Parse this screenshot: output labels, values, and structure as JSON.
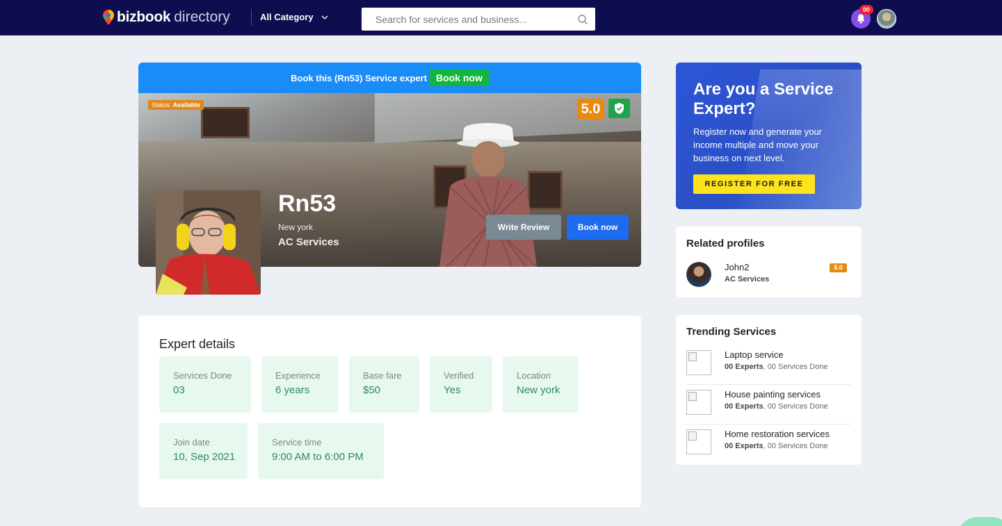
{
  "header": {
    "brand_bold": "bizbook",
    "brand_light": "directory",
    "category_label": "All Category",
    "search_placeholder": "Search for services and business...",
    "notification_count": "00"
  },
  "hero": {
    "banner_text": "Book this (Rn53) Service expert",
    "banner_button": "Book now",
    "status_label": "Status:",
    "status_value": "Available",
    "rating": "5.0",
    "name": "Rn53",
    "city": "New york",
    "service": "AC Services",
    "write_review": "Write Review",
    "book_now": "Book now"
  },
  "details": {
    "title": "Expert details",
    "items": [
      {
        "label": "Services Done",
        "value": "03"
      },
      {
        "label": "Experience",
        "value": "6 years"
      },
      {
        "label": "Base fare",
        "value": "$50"
      },
      {
        "label": "Verified",
        "value": "Yes"
      },
      {
        "label": "Location",
        "value": "New york"
      },
      {
        "label": "Join date",
        "value": "10, Sep 2021"
      },
      {
        "label": "Service time",
        "value": "9:00 AM to 6:00 PM"
      }
    ]
  },
  "promo": {
    "title": "Are you a Service Expert?",
    "text": "Register now and generate your income multiple and move your business on next level.",
    "button": "REGISTER FOR FREE"
  },
  "related": {
    "title": "Related profiles",
    "items": [
      {
        "name": "John2",
        "service": "AC Services",
        "rating": "5.0"
      }
    ]
  },
  "trending": {
    "title": "Trending Services",
    "items": [
      {
        "name": "Laptop service",
        "experts": "00 Experts",
        "done": ", 00 Services Done"
      },
      {
        "name": "House painting services",
        "experts": "00 Experts",
        "done": ", 00 Services Done"
      },
      {
        "name": "Home restoration services",
        "experts": "00 Experts",
        "done": ", 00 Services Done"
      }
    ]
  },
  "colors": {
    "header_bg": "#0e0d4f",
    "accent_blue": "#1a8cf8",
    "book_green": "#12b63e",
    "rating_orange": "#e88a10",
    "tile_bg": "#e7f8ef"
  }
}
